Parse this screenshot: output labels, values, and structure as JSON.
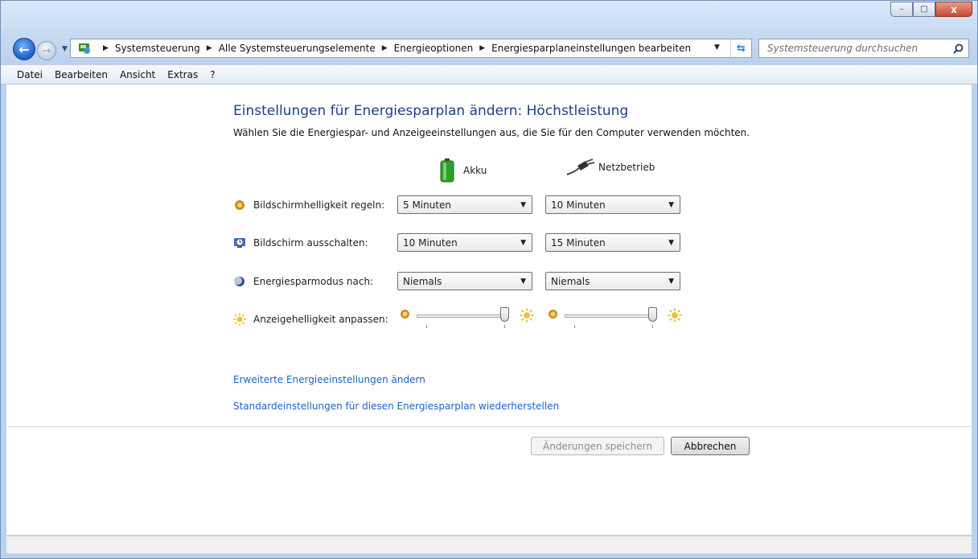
{
  "window": {
    "buttons": {
      "minimize": "–",
      "maximize": "□",
      "close": "x"
    }
  },
  "address_bar": {
    "breadcrumbs": [
      "Systemsteuerung",
      "Alle Systemsteuerungselemente",
      "Energieoptionen",
      "Energiesparplaneinstellungen bearbeiten"
    ],
    "search_placeholder": "Systemsteuerung durchsuchen"
  },
  "menu": {
    "items": [
      "Datei",
      "Bearbeiten",
      "Ansicht",
      "Extras",
      "?"
    ]
  },
  "page": {
    "title": "Einstellungen für Energiesparplan ändern: Höchstleistung",
    "subtitle": "Wählen Sie die Energiespar- und Anzeigeeinstellungen aus, die Sie für den Computer verwenden möchten.",
    "columns": {
      "battery": "Akku",
      "plugged": "Netzbetrieb"
    },
    "rows": [
      {
        "label": "Bildschirmhelligkeit regeln:",
        "battery": "5 Minuten",
        "plugged": "10 Minuten"
      },
      {
        "label": "Bildschirm ausschalten:",
        "battery": "10 Minuten",
        "plugged": "15 Minuten"
      },
      {
        "label": "Energiesparmodus nach:",
        "battery": "Niemals",
        "plugged": "Niemals"
      }
    ],
    "brightness": {
      "label": "Anzeigehelligkeit anpassen:",
      "battery_level": 100,
      "plugged_level": 100
    },
    "links": {
      "advanced": "Erweiterte Energieeinstellungen ändern",
      "restore": "Standardeinstellungen für diesen Energiesparplan wiederherstellen"
    },
    "buttons": {
      "save": "Änderungen speichern",
      "cancel": "Abbrechen"
    }
  },
  "colors": {
    "title": "#1e3f8c",
    "link": "#1a64c6",
    "accent": "#1d5fc6"
  }
}
